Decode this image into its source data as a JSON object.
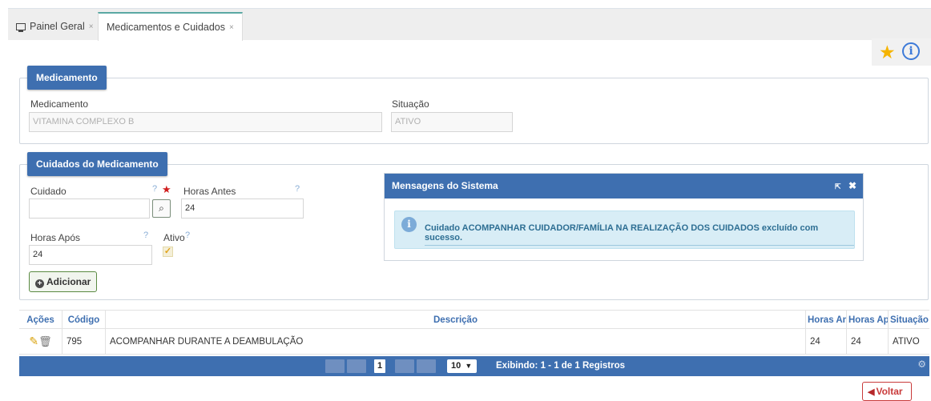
{
  "tabs": [
    {
      "label": "Painel Geral",
      "close": "×"
    },
    {
      "label": "Medicamentos e Cuidados",
      "close": "×"
    }
  ],
  "colors": {
    "primary": "#3e6fb0",
    "star": "#f5b400",
    "info": "#3d7ad8",
    "danger": "#c93a3a"
  },
  "medicamento": {
    "legend": "Medicamento",
    "medicamento_label": "Medicamento",
    "medicamento_value": "VITAMINA COMPLEXO B",
    "situacao_label": "Situação",
    "situacao_value": "ATIVO"
  },
  "cuidados": {
    "legend": "Cuidados do Medicamento",
    "cuidado_label": "Cuidado",
    "cuidado_value": "",
    "help": "?",
    "required": "★",
    "horas_antes_label": "Horas Antes",
    "horas_antes_value": "24",
    "horas_apos_label": "Horas Após",
    "horas_apos_value": "24",
    "ativo_label": "Ativo",
    "ativo_checked": true,
    "add_label": "Adicionar"
  },
  "dialog": {
    "title": "Mensagens do Sistema",
    "message": "Cuidado ACOMPANHAR CUIDADOR/FAMÍLIA NA REALIZAÇÃO DOS CUIDADOS excluído com sucesso."
  },
  "table": {
    "headers": [
      "Ações",
      "Código",
      "Descrição",
      "Horas Ant",
      "Horas Ap",
      "Situação"
    ],
    "rows": [
      {
        "codigo": "795",
        "descricao": "ACOMPANHAR DURANTE A DEAMBULAÇÃO",
        "horas_antes": "24",
        "horas_apos": "24",
        "situacao": "ATIVO"
      }
    ]
  },
  "pager": {
    "current_page": "1",
    "page_size": "10",
    "info": "Exibindo: 1 - 1 de 1 Registros"
  },
  "voltar_label": "Voltar"
}
